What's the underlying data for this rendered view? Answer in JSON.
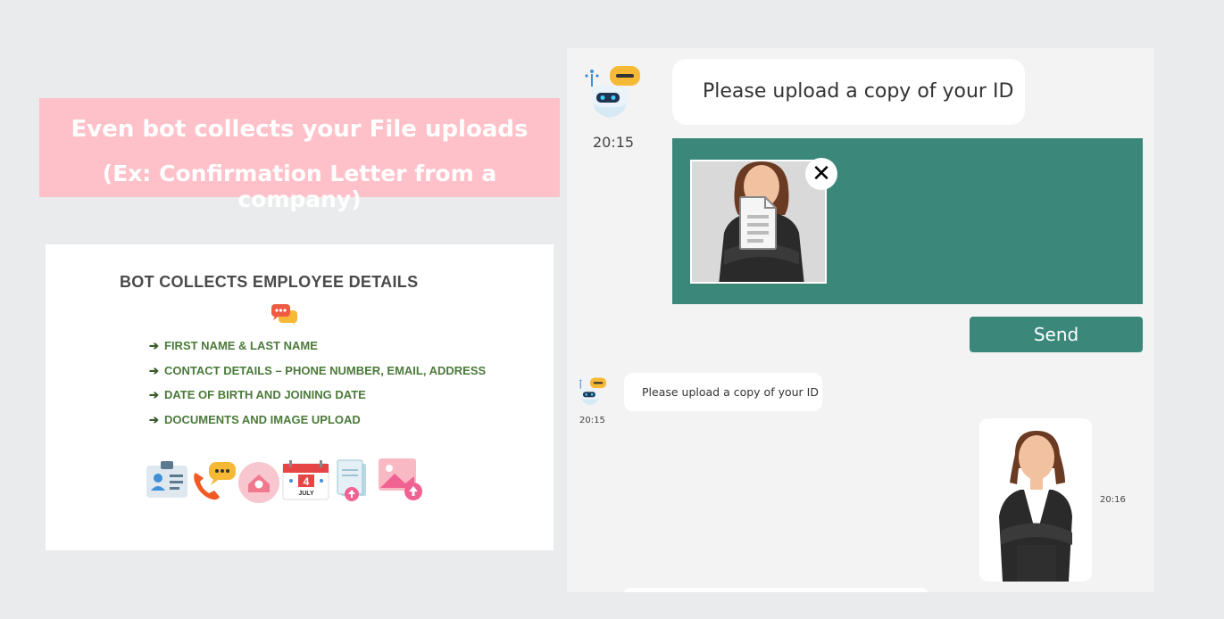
{
  "banner": {
    "line1": "Even bot collects your File uploads",
    "line2": "(Ex: Confirmation Letter from a company)"
  },
  "card": {
    "title": "BOT COLLECTS EMPLOYEE DETAILS",
    "items": [
      "FIRST NAME & LAST NAME",
      "CONTACT DETAILS – PHONE NUMBER, EMAIL, ADDRESS",
      "DATE OF BIRTH AND JOINING DATE",
      "DOCUMENTS AND IMAGE UPLOAD"
    ],
    "icons": [
      "id-card-icon",
      "phone-chat-icon",
      "home-location-icon",
      "calendar-icon",
      "document-upload-icon",
      "image-upload-icon"
    ],
    "calendar_day": "4",
    "calendar_month": "JULY"
  },
  "chat": {
    "message1": "Please upload a copy of your ID",
    "time1": "20:15",
    "close_label": "✕",
    "send_label": "Send",
    "message2": "Please upload a copy of your ID",
    "time2": "20:15",
    "time3": "20:16"
  },
  "colors": {
    "banner_bg": "#ffc1c9",
    "teal": "#3b887b",
    "list_green": "#4b7a3a",
    "background": "#e9ebec",
    "chat_bg": "#f3f3f3"
  }
}
